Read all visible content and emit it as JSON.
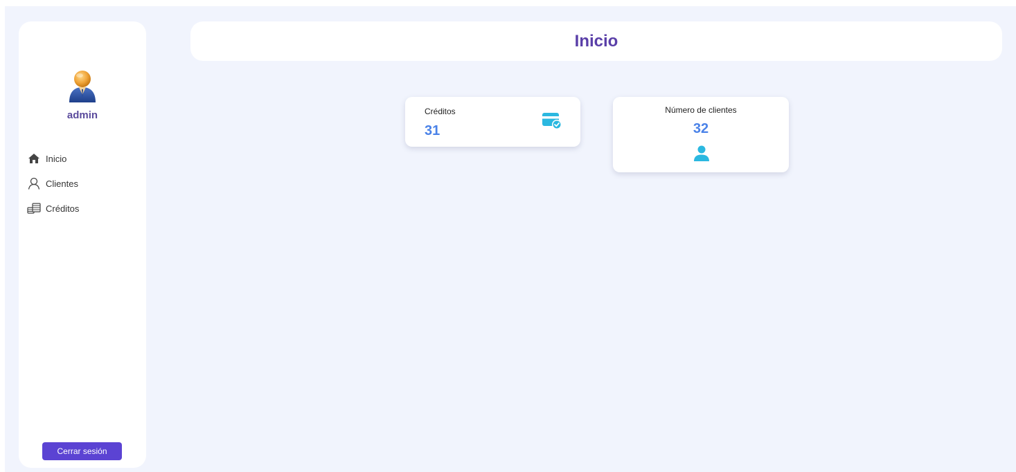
{
  "sidebar": {
    "username": "admin",
    "avatar_icon": "user-avatar-icon",
    "items": [
      {
        "label": "Inicio",
        "icon": "home-icon"
      },
      {
        "label": "Clientes",
        "icon": "user-outline-icon"
      },
      {
        "label": "Créditos",
        "icon": "money-stack-icon"
      }
    ],
    "logout_label": "Cerrar sesión"
  },
  "header": {
    "title": "Inicio"
  },
  "cards": {
    "creditos": {
      "label": "Créditos",
      "value": "31",
      "icon": "credit-card-check-icon"
    },
    "clientes": {
      "label": "Número de clientes",
      "value": "32",
      "icon": "person-icon"
    }
  },
  "colors": {
    "background": "#f1f4fd",
    "accent_purple": "#5b43d3",
    "title_purple": "#5a3fa8",
    "value_blue": "#4a82e8",
    "icon_cyan": "#2bb8e0"
  }
}
